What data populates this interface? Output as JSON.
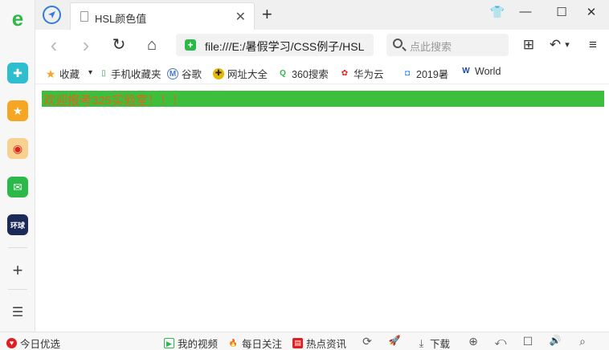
{
  "tab": {
    "title": "HSL颜色值",
    "close": "✕",
    "new_tab": "+"
  },
  "window": {
    "skin": "👕",
    "minimize": "—",
    "maximize": "☐",
    "close": "✕"
  },
  "address": {
    "url": "file:///E:/暑假学习/CSS例子/HSL",
    "secure_mark": "+"
  },
  "search": {
    "placeholder": "点此搜索"
  },
  "nav": {
    "back": "‹",
    "forward": "›",
    "reload": "↻",
    "home": "⌂",
    "apps": "⊞",
    "undo": "↶",
    "undo_menu": "▾",
    "menu": "≡"
  },
  "bookmarks": [
    {
      "label": "收藏",
      "icon": "★",
      "color": "#f5a623"
    },
    {
      "label": "▾",
      "icon": "",
      "color": ""
    },
    {
      "label": "手机收藏夹",
      "icon": "▯",
      "color": "#3aa55a"
    },
    {
      "label": "谷歌",
      "icon": "M",
      "color": "#4a78c8"
    },
    {
      "label": "网址大全",
      "icon": "✚",
      "color": "#e6b800"
    },
    {
      "label": "360搜索",
      "icon": "Q",
      "color": "#2db84a"
    },
    {
      "label": "华为云",
      "icon": "✿",
      "color": "#e02020"
    },
    {
      "label": "2019暑",
      "icon": "◘",
      "color": "#1e90ff"
    },
    {
      "label": "World",
      "icon": "W",
      "color": "#1a4aa0"
    }
  ],
  "sidebar": {
    "items": [
      {
        "name": "browser-logo",
        "glyph": "e",
        "color": "#2db84a"
      },
      {
        "name": "plugin",
        "glyph": "✚",
        "color": "#2dbfcf"
      },
      {
        "name": "favorites",
        "glyph": "★",
        "color": "#f5a623"
      },
      {
        "name": "weibo",
        "glyph": "◉",
        "color": "#f08c00"
      },
      {
        "name": "mail",
        "glyph": "✉",
        "color": "#2db84a"
      },
      {
        "name": "news",
        "glyph": "环球",
        "color": "#1c2a5a"
      },
      {
        "name": "add",
        "glyph": "+",
        "color": "#444"
      },
      {
        "name": "list",
        "glyph": "☰",
        "color": "#444"
      }
    ]
  },
  "page": {
    "banner_text": "欢迎报考325实验室！！！",
    "banner_bg": "#3dbf3d",
    "banner_fg": "#e0641a"
  },
  "status": {
    "left": {
      "label": "今日优选",
      "icon": "♥"
    },
    "items": [
      {
        "label": "我的视频",
        "icon": "▶",
        "color": "#2db84a"
      },
      {
        "label": "每日关注",
        "icon": "🔥",
        "color": "#f05a28"
      },
      {
        "label": "热点资讯",
        "icon": "▤",
        "color": "#e02020"
      }
    ],
    "download": "下载",
    "icons": [
      "⟳",
      "🚀",
      "⤓",
      "⊕",
      "⤺",
      "☐",
      "🔊",
      "⌕"
    ]
  }
}
